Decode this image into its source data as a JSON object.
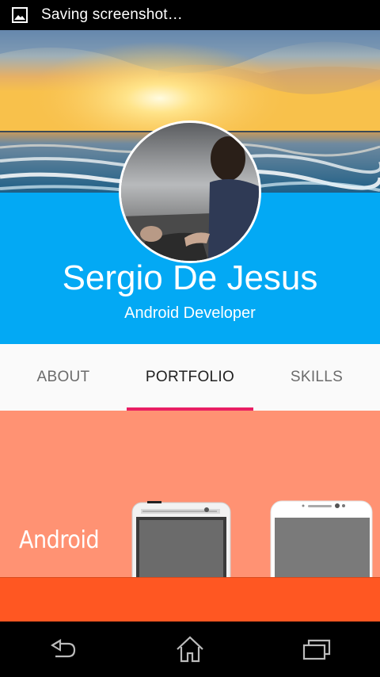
{
  "status_bar": {
    "text": "Saving screenshot…",
    "icon": "image-icon"
  },
  "profile": {
    "name": "Sergio De Jesus",
    "role": "Android Developer",
    "accent_color": "#03A9F4"
  },
  "tabs": [
    {
      "label": "ABOUT",
      "active": false
    },
    {
      "label": "PORTFOLIO",
      "active": true
    },
    {
      "label": "SKILLS",
      "active": false
    }
  ],
  "tab_indicator_color": "#E91E63",
  "portfolio": {
    "section_label": "Android",
    "background_color": "#FF9273",
    "footer_color": "#FF5722"
  },
  "nav_bar": {
    "buttons": [
      "back-icon",
      "home-icon",
      "recents-icon"
    ]
  }
}
